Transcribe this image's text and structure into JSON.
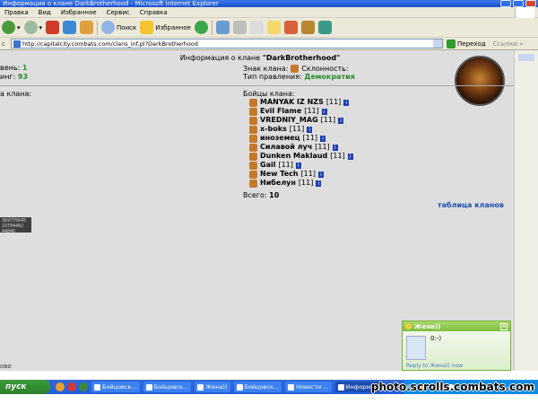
{
  "window": {
    "title": "Информация о клане DarkBrotherhood - Microsoft Internet Explorer"
  },
  "menu": [
    "Правка",
    "Вид",
    "Избранное",
    "Сервис",
    "Справка"
  ],
  "toolbar": {
    "search": "Поиск",
    "favorites": "Избранное"
  },
  "address": {
    "label": "с",
    "url": "http://capitalcity.combats.com/clans_inf.pl?DarkBrotherhood",
    "go": "Переход",
    "links": "Ссылки"
  },
  "clan": {
    "header_prefix": "Информация о клане ",
    "name": "\"DarkBrotherhood\"",
    "level_label": "вень:",
    "level": "1",
    "rating_label": "инг:",
    "rating": "93",
    "sign_label": "Знак клана:",
    "alignment_label": "Склонность:",
    "gov_label": "Тип правления:",
    "gov": "Демократия",
    "left_label": "а клана:",
    "fighters_title": "Бойцы клана:",
    "fighters": [
      {
        "name": "MANYAK IZ NZS",
        "level": "[11]"
      },
      {
        "name": "Evil Flame",
        "level": "[11]"
      },
      {
        "name": "VREDNIY_MAG",
        "level": "[11]"
      },
      {
        "name": "x-boks",
        "level": "[11]"
      },
      {
        "name": "иноземец",
        "level": "[11]"
      },
      {
        "name": "Силавой луч",
        "level": "[11]"
      },
      {
        "name": "Dunken Maklaud",
        "level": "[11]"
      },
      {
        "name": "Gail",
        "level": "[11]"
      },
      {
        "name": "New Tech",
        "level": "[11]"
      },
      {
        "name": "Нибелун",
        "level": "[11]"
      }
    ],
    "total_label": "Всего:",
    "total": "10",
    "clans_table_link": "таблица кланов",
    "info_glyph": "i"
  },
  "counter": {
    "lines": [
      "369775645",
      "23704402",
      "44846"
    ]
  },
  "status": {
    "text": "ово"
  },
  "chat": {
    "title": "Жена))",
    "message": "0:-)",
    "reply": "Reply to Жена)) now"
  },
  "taskbar": {
    "start": "пуск",
    "tasks": [
      "Бойцовск...",
      "Бойцовск...",
      "Жена))",
      "Бойцовск...",
      "Новости ...",
      "Информа..."
    ],
    "lang": "EN",
    "clock": "0:36"
  },
  "watermark": "photo.scrolls.combats.com"
}
